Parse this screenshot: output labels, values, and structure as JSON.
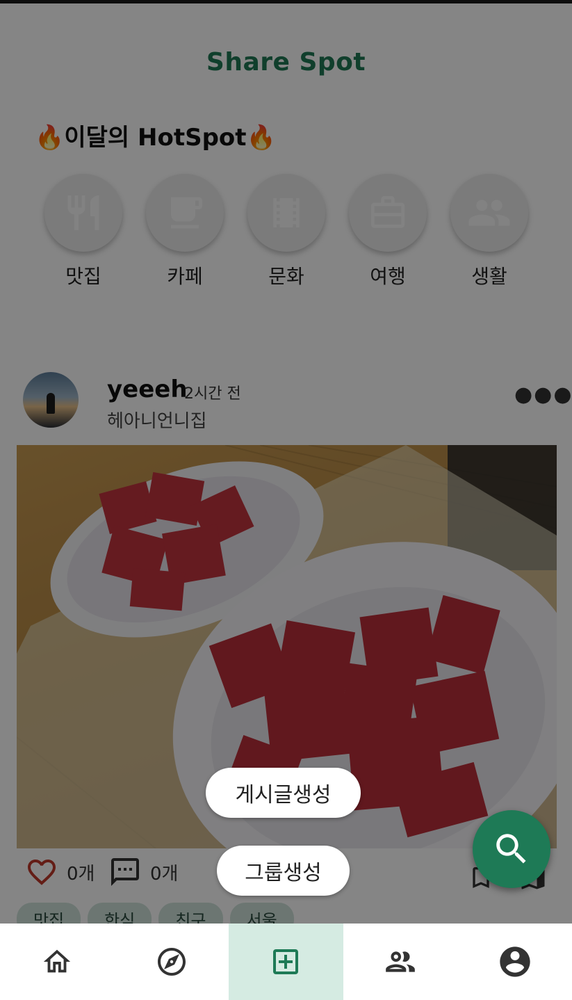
{
  "app": {
    "title": "Share Spot"
  },
  "hotspot": {
    "title": "🔥이달의 HotSpot🔥",
    "categories": [
      {
        "label": "맛집",
        "icon": "restaurant-icon"
      },
      {
        "label": "카페",
        "icon": "cafe-icon"
      },
      {
        "label": "문화",
        "icon": "movie-icon"
      },
      {
        "label": "여행",
        "icon": "luggage-icon"
      },
      {
        "label": "생활",
        "icon": "people-icon"
      }
    ]
  },
  "post": {
    "username": "yeeeh",
    "time_ago": "2시간 전",
    "place": "헤아니언니집",
    "photo_alt": "watermelon plates",
    "likes": "0개",
    "comments": "0개",
    "tags": [
      "맛집",
      "한식",
      "친구",
      "서울"
    ]
  },
  "fab_menu": {
    "create_post": "게시글생성",
    "create_group": "그룹생성"
  },
  "bottom_nav": {
    "items": [
      {
        "name": "home",
        "icon": "home-icon"
      },
      {
        "name": "explore",
        "icon": "compass-icon"
      },
      {
        "name": "add",
        "icon": "add-box-icon",
        "active": true
      },
      {
        "name": "friends",
        "icon": "group-icon"
      },
      {
        "name": "profile",
        "icon": "account-icon"
      }
    ]
  },
  "colors": {
    "brand": "#1f7a55",
    "fab": "#1e7a56",
    "active_tab_bg": "#d5ebe2",
    "like": "#c0392b"
  }
}
